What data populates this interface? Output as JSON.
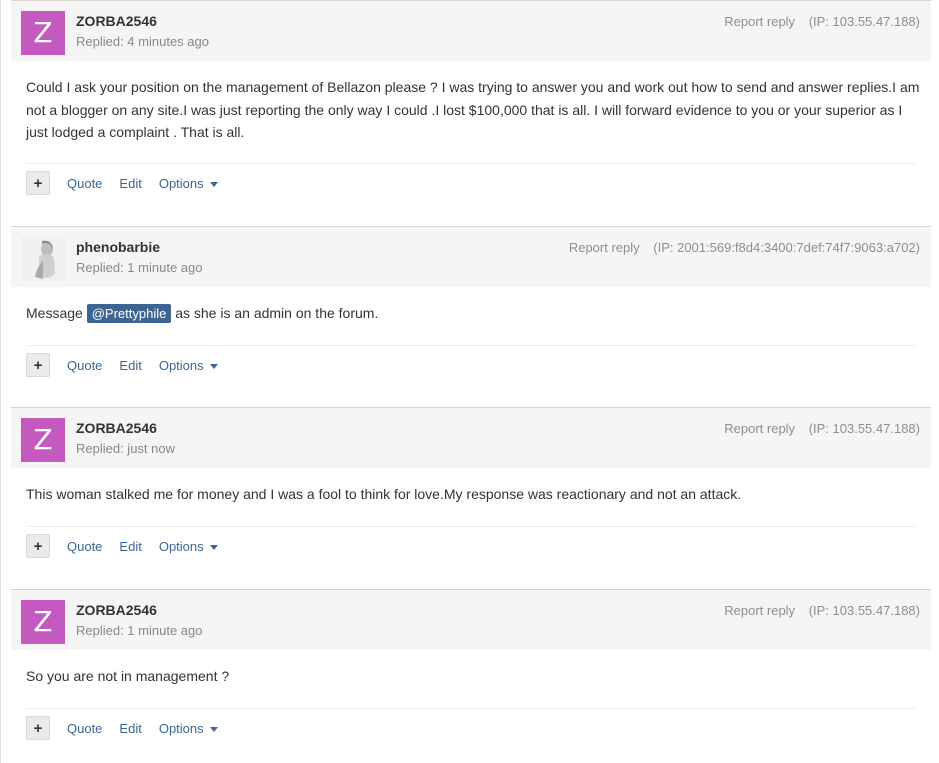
{
  "posts": [
    {
      "avatar_letter": "Z",
      "author": "ZORBA2546",
      "replied": "Replied: 4 minutes ago",
      "report": "Report reply",
      "ip": "(IP: 103.55.47.188)",
      "body": "Could I ask your position on the management of Bellazon please ? I was trying to answer you and work out how to send and answer replies.I am not a blogger on any site.I was just reporting the only way I could .I lost $100,000 that is all. I will forward evidence to you or your superior as I just lodged a complaint . That is all."
    },
    {
      "author": "phenobarbie",
      "replied": "Replied: 1 minute ago",
      "report": "Report reply",
      "ip": "(IP: 2001:569:f8d4:3400:7def:74f7:9063:a702)",
      "body_before": "Message",
      "mention": "@Prettyphile",
      "body_after": "as she is an admin on the forum."
    },
    {
      "avatar_letter": "Z",
      "author": "ZORBA2546",
      "replied": "Replied: just now",
      "report": "Report reply",
      "ip": "(IP: 103.55.47.188)",
      "body": "This woman stalked me for money and I was a fool to think for love.My response was reactionary and not an attack."
    },
    {
      "avatar_letter": "Z",
      "author": "ZORBA2546",
      "replied": "Replied: 1 minute ago",
      "report": "Report reply",
      "ip": "(IP: 103.55.47.188)",
      "body": "So you are not in management ?"
    }
  ],
  "actions": {
    "plus": "+",
    "quote": "Quote",
    "edit": "Edit",
    "options": "Options"
  },
  "colors": {
    "avatar_bg": "#c45ac0",
    "link": "#3d6594",
    "header_bg": "#f5f5f5"
  },
  "icons": {
    "plus": "plus-icon",
    "caret": "chevron-down-icon"
  }
}
